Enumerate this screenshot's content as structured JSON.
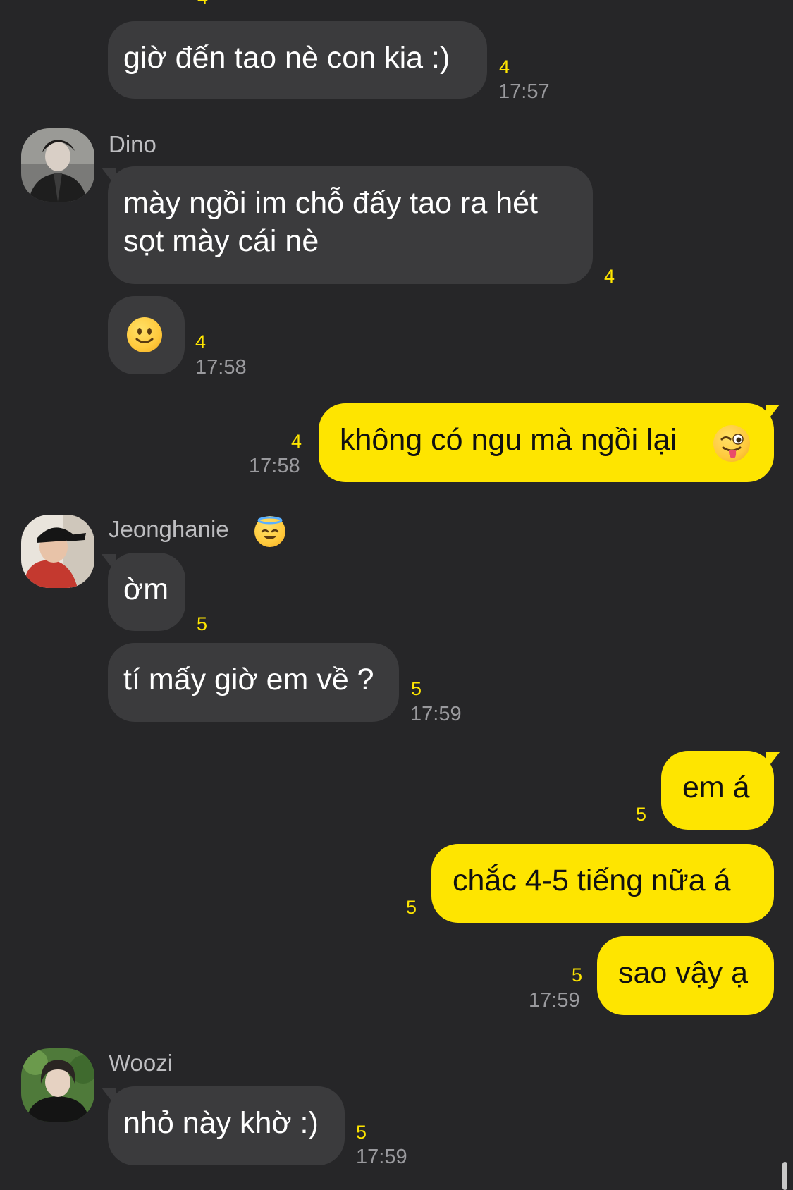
{
  "messages": {
    "m1": {
      "text": "giờ đến tao nè con kia :)",
      "count": "4",
      "time": "17:57"
    },
    "dino": {
      "name": "Dino",
      "avatar_icon": "user-photo",
      "m2": {
        "text_line1": "mày ngồi im chỗ đấy tao ra hét",
        "text_line2": "sọt mày cái nè",
        "count": "4"
      },
      "m3": {
        "emoji": "slightly-smiling-face",
        "count": "4",
        "time": "17:58"
      }
    },
    "me1": {
      "text": "không có ngu mà ngồi lại",
      "emoji": "winking-face-with-tongue",
      "count": "4",
      "time": "17:58"
    },
    "jeonghanie": {
      "name": "Jeonghanie",
      "name_emoji": "smiling-face-with-halo",
      "avatar_icon": "user-photo",
      "m4": {
        "text": "ờm",
        "count": "5"
      },
      "m5": {
        "text": "tí mấy giờ em về ?",
        "count": "5",
        "time": "17:59"
      }
    },
    "me2": {
      "m6": {
        "text": "em á",
        "count": "5"
      },
      "m7": {
        "text": "chắc 4-5 tiếng nữa á",
        "count": "5"
      },
      "m8": {
        "text": "sao vậy ạ",
        "count": "5",
        "time": "17:59"
      }
    },
    "woozi": {
      "name": "Woozi",
      "avatar_icon": "user-photo",
      "m9": {
        "text": "nhỏ này khờ :)",
        "count": "5",
        "time": "17:59"
      }
    }
  },
  "colors": {
    "background": "#262628",
    "incoming_bubble": "#3b3b3d",
    "outgoing_bubble": "#fee500",
    "unread_count": "#fee500"
  }
}
